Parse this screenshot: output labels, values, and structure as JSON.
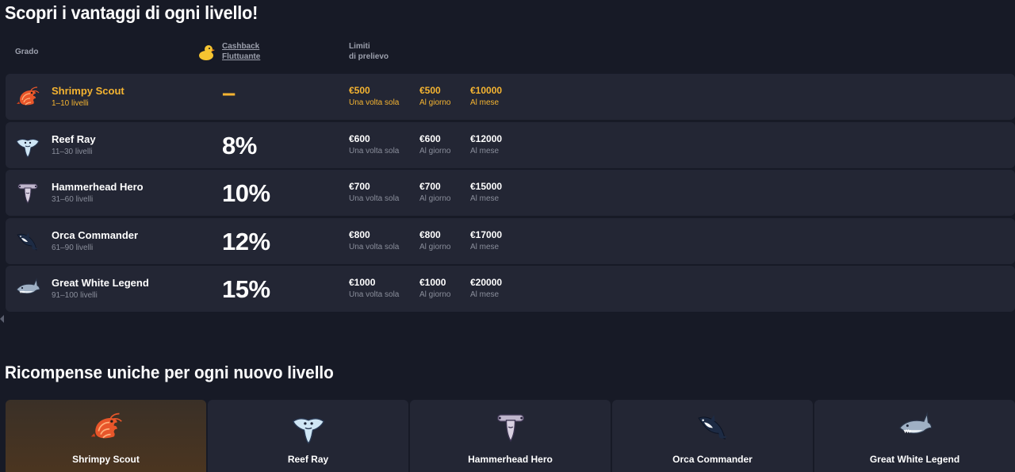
{
  "page_title": "Scopri i vantaggi di ogni livello!",
  "header": {
    "grado": "Grado",
    "cashback_line1": "Cashback",
    "cashback_line2": "Fluttuante",
    "limiti_line1": "Limiti",
    "limiti_line2": "di prelievo"
  },
  "levels": [
    {
      "name": "Shrimpy Scout",
      "range": "1–10 livelli",
      "cashback": "–",
      "icon": "shrimp-icon",
      "lim1": "€500",
      "lim1_sub": "Una volta sola",
      "lim2": "€500",
      "lim2_sub": "Al giorno",
      "lim3": "€10000",
      "lim3_sub": "Al mese"
    },
    {
      "name": "Reef Ray",
      "range": "11–30 livelli",
      "cashback": "8%",
      "icon": "ray-icon",
      "lim1": "€600",
      "lim1_sub": "Una volta sola",
      "lim2": "€600",
      "lim2_sub": "Al giorno",
      "lim3": "€12000",
      "lim3_sub": "Al mese"
    },
    {
      "name": "Hammerhead Hero",
      "range": "31–60 livelli",
      "cashback": "10%",
      "icon": "hammerhead-icon",
      "lim1": "€700",
      "lim1_sub": "Una volta sola",
      "lim2": "€700",
      "lim2_sub": "Al giorno",
      "lim3": "€15000",
      "lim3_sub": "Al mese"
    },
    {
      "name": "Orca Commander",
      "range": "61–90 livelli",
      "cashback": "12%",
      "icon": "orca-icon",
      "lim1": "€800",
      "lim1_sub": "Una volta sola",
      "lim2": "€800",
      "lim2_sub": "Al giorno",
      "lim3": "€17000",
      "lim3_sub": "Al mese"
    },
    {
      "name": "Great White Legend",
      "range": "91–100 livelli",
      "cashback": "15%",
      "icon": "shark-icon",
      "lim1": "€1000",
      "lim1_sub": "Una volta sola",
      "lim2": "€1000",
      "lim2_sub": "Al giorno",
      "lim3": "€20000",
      "lim3_sub": "Al mese"
    }
  ],
  "rewards_title": "Ricompense uniche per ogni nuovo livello",
  "reward_cards": [
    {
      "name": "Shrimpy Scout",
      "icon": "shrimp-icon"
    },
    {
      "name": "Reef Ray",
      "icon": "ray-icon"
    },
    {
      "name": "Hammerhead Hero",
      "icon": "hammerhead-icon"
    },
    {
      "name": "Orca Commander",
      "icon": "orca-icon"
    },
    {
      "name": "Great White Legend",
      "icon": "shark-icon"
    }
  ],
  "colors": {
    "accent": "#f5b431",
    "background": "#171a26",
    "row": "#232634",
    "muted": "#8a8e9b"
  }
}
